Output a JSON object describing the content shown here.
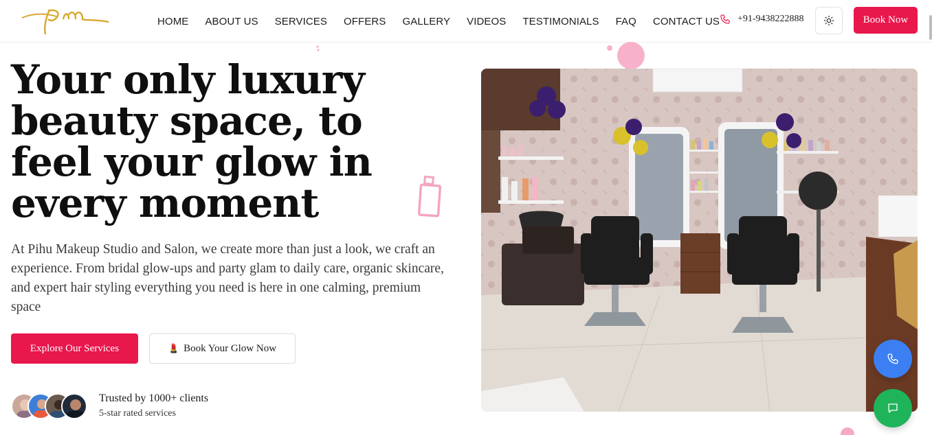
{
  "brand": {
    "logo_text": "pm",
    "accent": "#e8174c",
    "logo_color": "#d8a72f"
  },
  "nav": {
    "items": [
      {
        "label": "HOME"
      },
      {
        "label": "ABOUT US"
      },
      {
        "label": "SERVICES"
      },
      {
        "label": "OFFERS"
      },
      {
        "label": "GALLERY"
      },
      {
        "label": "VIDEOS"
      },
      {
        "label": "TESTIMONIALS"
      },
      {
        "label": "FAQ"
      },
      {
        "label": "CONTACT US"
      }
    ],
    "phone": "+91-9438222888",
    "book_label": "Book Now"
  },
  "hero": {
    "headline": "Your only luxury beauty space, to feel your glow in every moment",
    "description": "At Pihu Makeup Studio and Salon, we create more than just a look, we craft an experience. From bridal glow-ups and party glam to daily care, organic skincare, and expert hair styling everything you need is here in one calming, premium space",
    "primary_cta": "Explore Our Services",
    "secondary_cta_icon": "💄",
    "secondary_cta": "Book Your Glow Now",
    "trust_title": "Trusted by 1000+ clients",
    "trust_subtitle": "5-star rated services"
  },
  "icons": {
    "phone": "phone-icon",
    "theme": "sun-icon",
    "call_fab": "phone-icon",
    "chat_fab": "chat-bubble-icon"
  },
  "colors": {
    "call_fab": "#3b7ff2",
    "chat_fab": "#1fb35a",
    "decor_pink": "#f7a8c4"
  }
}
